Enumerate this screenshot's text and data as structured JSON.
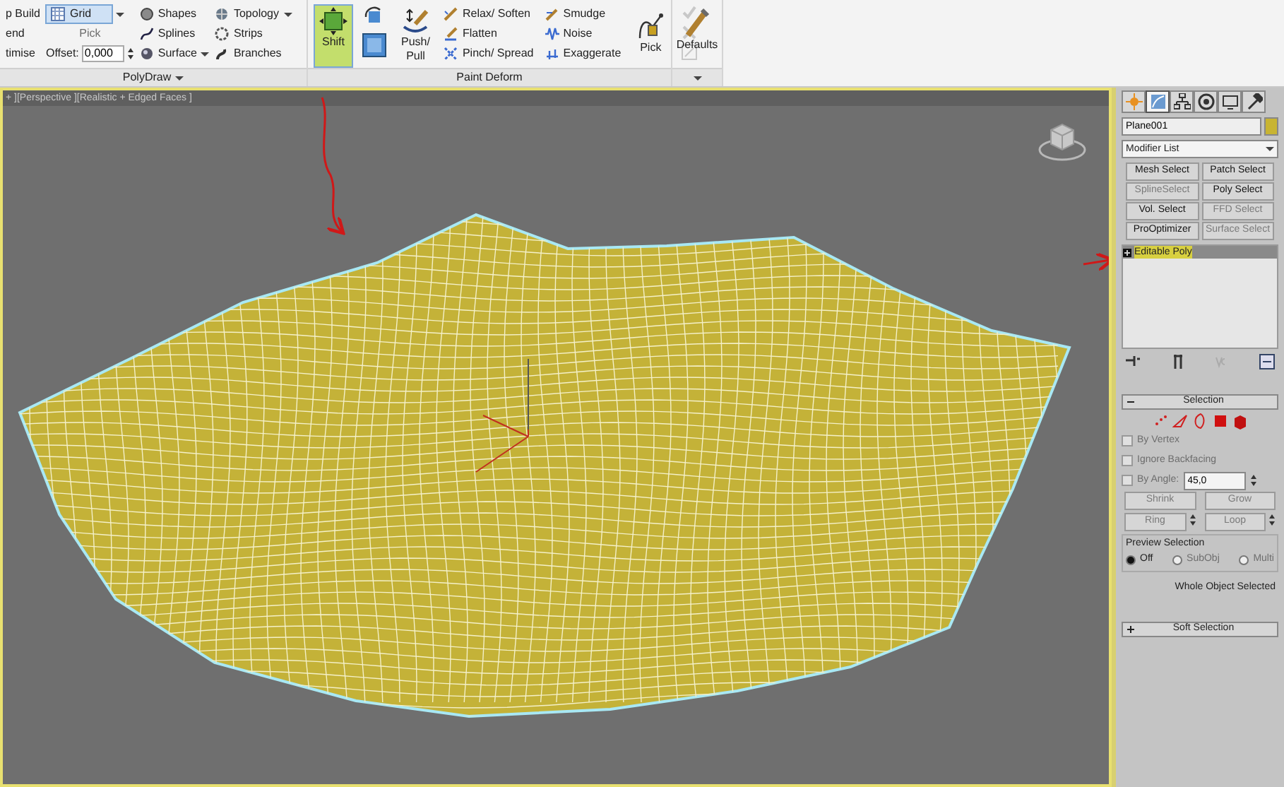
{
  "ribbon": {
    "cut_column": [
      "p Build",
      "end",
      "timise"
    ],
    "polydraw": {
      "title": "PolyDraw",
      "grid": "Grid",
      "pick": {
        "label": "Pick",
        "disabled": true
      },
      "offset_label": "Offset:",
      "offset_value": "0,000",
      "tools": [
        {
          "label": "Shapes",
          "dropdown": false
        },
        {
          "label": "Splines",
          "dropdown": false
        },
        {
          "label": "Surface",
          "dropdown": true
        },
        {
          "label": "Topology",
          "dropdown": true
        },
        {
          "label": "Strips",
          "dropdown": false
        },
        {
          "label": "Branches",
          "dropdown": false
        }
      ]
    },
    "paint_deform": {
      "title": "Paint Deform",
      "shift": {
        "label": "Shift",
        "selected": true
      },
      "push_pull": "Push/ Pull",
      "tools": [
        "Relax/ Soften",
        "Flatten",
        "Pinch/ Spread",
        "Smudge",
        "Noise",
        "Exaggerate"
      ],
      "pick": "Pick"
    },
    "defaults": {
      "label": "Defaults"
    }
  },
  "viewport": {
    "label": "+ ][Perspective ][Realistic + Edged Faces ]",
    "active": true
  },
  "command_panel": {
    "tabs": [
      {
        "selected": false
      },
      {
        "selected": true
      },
      {
        "selected": false
      },
      {
        "selected": false
      },
      {
        "selected": false
      },
      {
        "selected": false
      }
    ],
    "object_name": "Plane001",
    "modifier_list": "Modifier List",
    "modifier_buttons": [
      {
        "label": "Mesh Select",
        "disabled": false
      },
      {
        "label": "Patch Select",
        "disabled": false
      },
      {
        "label": "SplineSelect",
        "disabled": true
      },
      {
        "label": "Poly Select",
        "disabled": false
      },
      {
        "label": "Vol. Select",
        "disabled": false
      },
      {
        "label": "FFD Select",
        "disabled": true
      },
      {
        "label": "ProOptimizer",
        "disabled": false
      },
      {
        "label": "Surface Select",
        "disabled": true
      }
    ],
    "stack": [
      {
        "label": "Editable Poly",
        "selected": true
      }
    ],
    "selection": {
      "title": "Selection",
      "expanded": true,
      "checkboxes": [
        {
          "label": "By Vertex",
          "checked": false,
          "disabled": true
        },
        {
          "label": "Ignore Backfacing",
          "checked": false,
          "disabled": true
        },
        {
          "label": "By Angle:",
          "checked": false,
          "disabled": true
        }
      ],
      "angle": "45,0",
      "buttons": [
        {
          "label": "Shrink",
          "disabled": true
        },
        {
          "label": "Grow",
          "disabled": true
        },
        {
          "label": "Ring",
          "disabled": true
        },
        {
          "label": "Loop",
          "disabled": true
        }
      ],
      "preview": {
        "title": "Preview Selection",
        "options": [
          {
            "label": "Off",
            "selected": true,
            "disabled": false
          },
          {
            "label": "SubObj",
            "selected": false,
            "disabled": true
          },
          {
            "label": "Multi",
            "selected": false,
            "disabled": true
          }
        ]
      },
      "status": "Whole Object Selected"
    },
    "soft_selection": {
      "title": "Soft Selection",
      "expanded": false
    }
  }
}
